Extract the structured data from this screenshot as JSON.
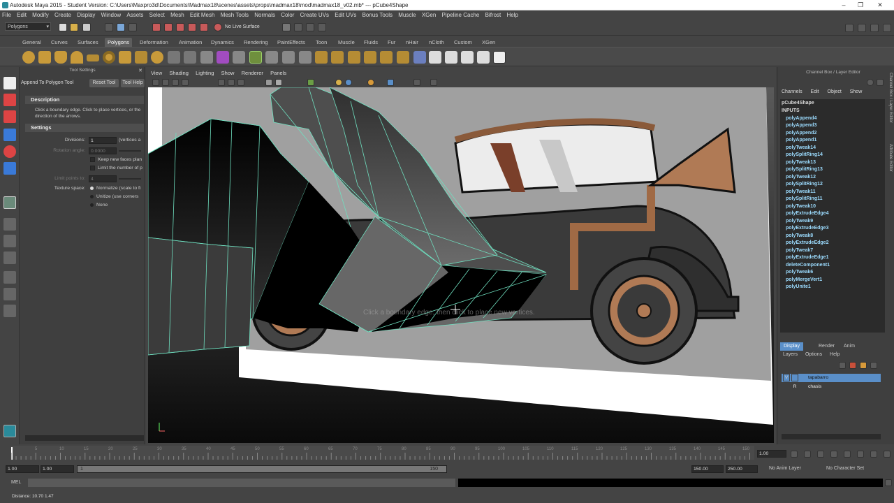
{
  "window": {
    "title": "Autodesk Maya 2015 - Student Version: C:\\Users\\Maxpro3d\\Documents\\Madmax18\\scenes\\assets\\props\\madmax18\\mod\\madmax18_v02.mb*   ---   pCube4Shape"
  },
  "menu": [
    "File",
    "Edit",
    "Modify",
    "Create",
    "Display",
    "Window",
    "Assets",
    "Select",
    "Mesh",
    "Edit Mesh",
    "Mesh Tools",
    "Normals",
    "Color",
    "Create UVs",
    "Edit UVs",
    "Bonus Tools",
    "Muscle",
    "XGen",
    "Pipeline Cache",
    "Bifrost",
    "Help"
  ],
  "status": {
    "mode": "Polygons",
    "live_surface": "No Live Surface"
  },
  "shelf_tabs": [
    "General",
    "Curves",
    "Surfaces",
    "Polygons",
    "Deformation",
    "Animation",
    "Dynamics",
    "Rendering",
    "PaintEffects",
    "Toon",
    "Muscle",
    "Fluids",
    "Fur",
    "nHair",
    "nCloth",
    "Custom",
    "XGen"
  ],
  "shelf_active": "Polygons",
  "tool_settings": {
    "panel_title": "Tool Settings",
    "tool_name": "Append To Polygon Tool",
    "reset_label": "Reset Tool",
    "help_label": "Tool Help",
    "description_header": "Description",
    "description": "Click a boundary edge. Click to place vertices, or the direction of the arrows.",
    "settings_header": "Settings",
    "divisions_label": "Divisions:",
    "divisions_value": "1",
    "divisions_suffix": "(vertices a",
    "rotation_label": "Rotation angle:",
    "rotation_value": "0.0000",
    "keep_faces": "Keep new faces plan",
    "limit_points": "Limit the number of p",
    "limit_label": "Limit points to:",
    "limit_value": "4",
    "texture_label": "Texture space:",
    "tex_options": [
      "Normalize (scale to fi",
      "Unitize (use corners",
      "None"
    ]
  },
  "viewport": {
    "menu": [
      "View",
      "Shading",
      "Lighting",
      "Show",
      "Renderer",
      "Panels"
    ],
    "hud": "Click a boundary edge, then click to place new vertices."
  },
  "channel_box": {
    "title": "Channel Box / Layer Editor",
    "menu": [
      "Channels",
      "Edit",
      "Object",
      "Show"
    ],
    "object": "pCube4Shape",
    "inputs_label": "INPUTS",
    "inputs": [
      "polyAppend4",
      "polyAppend3",
      "polyAppend2",
      "polyAppend1",
      "polyTweak14",
      "polySplitRing14",
      "polyTweak13",
      "polySplitRing13",
      "polyTweak12",
      "polySplitRing12",
      "polyTweak11",
      "polySplitRing11",
      "polyTweak10",
      "polyExtrudeEdge4",
      "polyTweak9",
      "polyExtrudeEdge3",
      "polyTweak8",
      "polyExtrudeEdge2",
      "polyTweak7",
      "polyExtrudeEdge1",
      "deleteComponent1",
      "polyTweak6",
      "polyMergeVert1",
      "polyUnite1"
    ],
    "side_tabs": [
      "Channel Box / Layer Editor",
      "Attribute Editor"
    ]
  },
  "layer_editor": {
    "tabs": [
      "Display",
      "Render",
      "Anim"
    ],
    "menu": [
      "Layers",
      "Options",
      "Help"
    ],
    "layers": [
      {
        "v": "V",
        "name": "tapabarro",
        "selected": true
      },
      {
        "v": "R",
        "name": "chasis",
        "selected": false
      }
    ]
  },
  "timeline": {
    "ticks": [
      "5",
      "10",
      "15",
      "20",
      "25",
      "30",
      "35",
      "40",
      "45",
      "50",
      "55",
      "60",
      "65",
      "70",
      "75",
      "80",
      "85",
      "90",
      "95",
      "100",
      "105",
      "110",
      "115",
      "120",
      "125",
      "130",
      "135",
      "140",
      "145",
      "150"
    ],
    "current": "1.00"
  },
  "range": {
    "start": "1.00",
    "start2": "1.00",
    "inner_start": "1",
    "inner_end": "150",
    "end": "150.00",
    "end2": "250.00",
    "anim_layer": "No Anim Layer",
    "character_set": "No Character Set"
  },
  "command": {
    "label": "MEL"
  },
  "help": {
    "text": "Distance: 10.70  1.47"
  }
}
